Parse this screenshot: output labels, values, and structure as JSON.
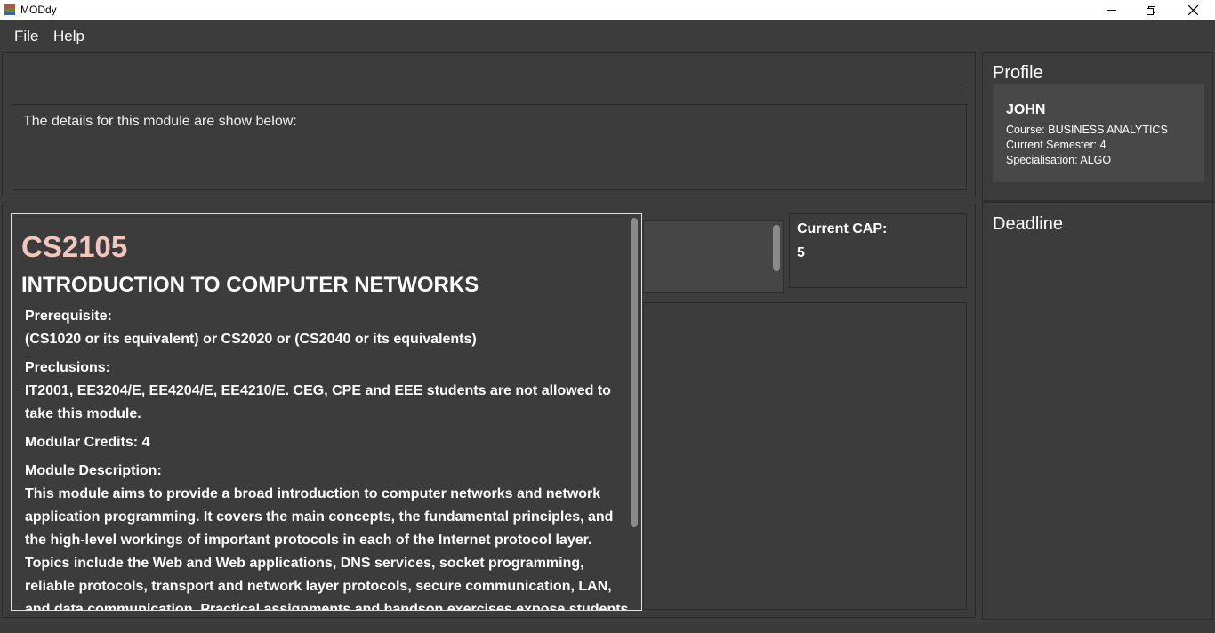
{
  "window": {
    "title": "MODdy"
  },
  "menu": {
    "items": [
      "File",
      "Help"
    ]
  },
  "command": {
    "input_value": "",
    "result": "The details for this module are show below:"
  },
  "module": {
    "code": "CS2105",
    "title": "INTRODUCTION TO COMPUTER NETWORKS",
    "sections": [
      {
        "label": "Prerequisite:",
        "text": "(CS1020 or its equivalent) or CS2020 or (CS2040 or its equivalents)"
      },
      {
        "label": "Preclusions:",
        "text": "IT2001, EE3204/E, EE4204/E, EE4210/E. CEG, CPE and EEE students are not allowed to take this module."
      },
      {
        "label": "Modular Credits: 4",
        "text": ""
      },
      {
        "label": "Module Description:",
        "text": "This module aims to provide a broad introduction to computer networks and network application programming. It covers the main concepts, the fundamental principles, and the high-level workings of important protocols in each of the Internet protocol layer. Topics include the Web and Web applications, DNS services, socket programming, reliable protocols, transport and network layer protocols, secure communication, LAN, and data communication. Practical assignments and handson exercises expose students"
      }
    ]
  },
  "cap": {
    "label": "Current CAP:",
    "value": "5"
  },
  "profile": {
    "heading": "Profile",
    "name": "JOHN",
    "course": "Course: BUSINESS ANALYTICS",
    "semester": "Current Semester: 4",
    "specialisation": "Specialisation: ALGO"
  },
  "deadline": {
    "heading": "Deadline"
  }
}
